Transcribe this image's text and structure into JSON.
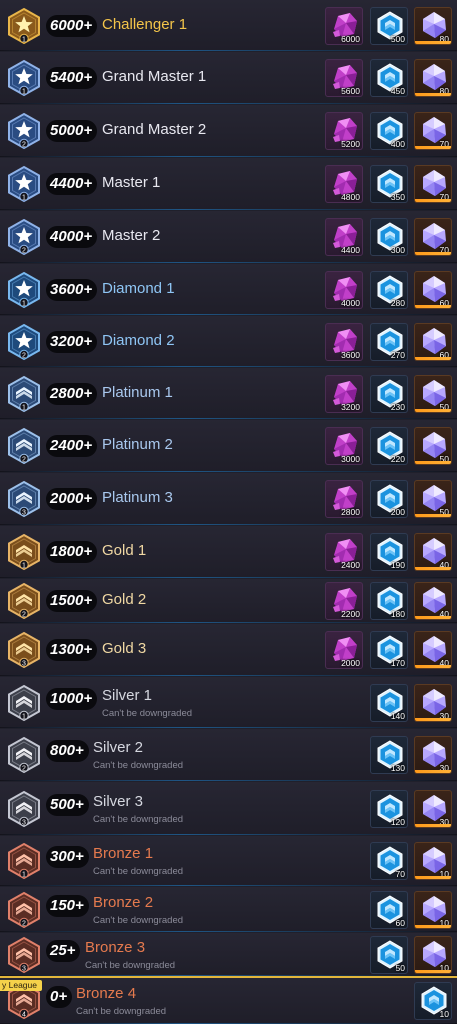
{
  "tiers": [
    {
      "score": "6000+",
      "name": "Challenger 1",
      "sub": "",
      "rank_num": "1",
      "style": "challenger",
      "rewards": {
        "gem": "6000",
        "chip": "500",
        "crystal": "80"
      }
    },
    {
      "score": "5400+",
      "name": "Grand Master 1",
      "sub": "",
      "rank_num": "1",
      "style": "grandmaster",
      "rewards": {
        "gem": "5600",
        "chip": "450",
        "crystal": "80"
      }
    },
    {
      "score": "5000+",
      "name": "Grand Master 2",
      "sub": "",
      "rank_num": "2",
      "style": "grandmaster",
      "rewards": {
        "gem": "5200",
        "chip": "400",
        "crystal": "70"
      }
    },
    {
      "score": "4400+",
      "name": "Master 1",
      "sub": "",
      "rank_num": "1",
      "style": "master",
      "rewards": {
        "gem": "4800",
        "chip": "350",
        "crystal": "70"
      }
    },
    {
      "score": "4000+",
      "name": "Master 2",
      "sub": "",
      "rank_num": "2",
      "style": "master",
      "rewards": {
        "gem": "4400",
        "chip": "300",
        "crystal": "70"
      }
    },
    {
      "score": "3600+",
      "name": "Diamond 1",
      "sub": "",
      "rank_num": "1",
      "style": "diamond",
      "rewards": {
        "gem": "4000",
        "chip": "280",
        "crystal": "60"
      }
    },
    {
      "score": "3200+",
      "name": "Diamond 2",
      "sub": "",
      "rank_num": "2",
      "style": "diamond",
      "rewards": {
        "gem": "3600",
        "chip": "270",
        "crystal": "60"
      }
    },
    {
      "score": "2800+",
      "name": "Platinum 1",
      "sub": "",
      "rank_num": "1",
      "style": "platinum",
      "rewards": {
        "gem": "3200",
        "chip": "230",
        "crystal": "50"
      }
    },
    {
      "score": "2400+",
      "name": "Platinum 2",
      "sub": "",
      "rank_num": "2",
      "style": "platinum",
      "rewards": {
        "gem": "3000",
        "chip": "220",
        "crystal": "50"
      }
    },
    {
      "score": "2000+",
      "name": "Platinum 3",
      "sub": "",
      "rank_num": "3",
      "style": "platinum",
      "rewards": {
        "gem": "2800",
        "chip": "200",
        "crystal": "50"
      }
    },
    {
      "score": "1800+",
      "name": "Gold 1",
      "sub": "",
      "rank_num": "1",
      "style": "gold",
      "rewards": {
        "gem": "2400",
        "chip": "190",
        "crystal": "40"
      }
    },
    {
      "score": "1500+",
      "name": "Gold 2",
      "sub": "",
      "rank_num": "2",
      "style": "gold",
      "rewards": {
        "gem": "2200",
        "chip": "180",
        "crystal": "40"
      }
    },
    {
      "score": "1300+",
      "name": "Gold 3",
      "sub": "",
      "rank_num": "3",
      "style": "gold",
      "rewards": {
        "gem": "2000",
        "chip": "170",
        "crystal": "40"
      }
    },
    {
      "score": "1000+",
      "name": "Silver 1",
      "sub": "Can't be downgraded",
      "rank_num": "1",
      "style": "silver",
      "rewards": {
        "chip": "140",
        "crystal": "30"
      }
    },
    {
      "score": "800+",
      "name": "Silver 2",
      "sub": "Can't be downgraded",
      "rank_num": "2",
      "style": "silver",
      "rewards": {
        "chip": "130",
        "crystal": "30"
      }
    },
    {
      "score": "500+",
      "name": "Silver 3",
      "sub": "Can't be downgraded",
      "rank_num": "3",
      "style": "silver",
      "rewards": {
        "chip": "120",
        "crystal": "30"
      }
    },
    {
      "score": "300+",
      "name": "Bronze 1",
      "sub": "Can't be downgraded",
      "rank_num": "1",
      "style": "bronze",
      "rewards": {
        "chip": "70",
        "crystal": "10"
      }
    },
    {
      "score": "150+",
      "name": "Bronze 2",
      "sub": "Can't be downgraded",
      "rank_num": "2",
      "style": "bronze",
      "rewards": {
        "chip": "60",
        "crystal": "10"
      }
    },
    {
      "score": "25+",
      "name": "Bronze 3",
      "sub": "Can't be downgraded",
      "rank_num": "3",
      "style": "bronze",
      "rewards": {
        "chip": "50",
        "crystal": "10"
      }
    },
    {
      "score": "0+",
      "name": "Bronze 4",
      "sub": "Can't be downgraded",
      "rank_num": "4",
      "style": "bronze",
      "rewards": {
        "chip": "10"
      }
    }
  ],
  "current_tag": "y League",
  "colors": {
    "gold_accent": "#f4c54a",
    "crystal_bar": "#ff9a1a",
    "diamond_text": "#8fc6f5",
    "bronze_text": "#e57a4e"
  },
  "icons": {
    "gem": "purple-gem-icon",
    "chip": "blue-hex-chip-icon",
    "crystal": "violet-crystal-icon"
  }
}
